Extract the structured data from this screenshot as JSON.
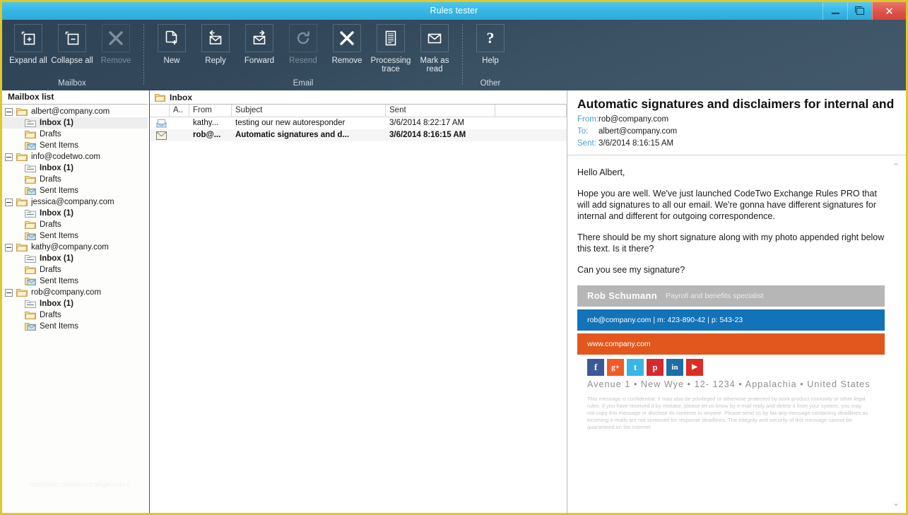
{
  "window": {
    "title": "Rules tester",
    "minimize_label": "Minimize",
    "maximize_label": "Restore",
    "close_label": "✕"
  },
  "ribbon": {
    "groups": [
      {
        "name": "Mailbox",
        "label": "Mailbox",
        "buttons": [
          {
            "id": "expand-all",
            "label": "Expand all",
            "icon": "expand-all-icon",
            "disabled": false
          },
          {
            "id": "collapse-all",
            "label": "Collapse all",
            "icon": "collapse-all-icon",
            "disabled": false
          },
          {
            "id": "remove-mailbox",
            "label": "Remove",
            "icon": "close-x-icon",
            "disabled": true
          }
        ]
      },
      {
        "name": "Email",
        "label": "Email",
        "buttons": [
          {
            "id": "new",
            "label": "New",
            "icon": "new-document-icon",
            "disabled": false
          },
          {
            "id": "reply",
            "label": "Reply",
            "icon": "reply-envelope-icon",
            "disabled": false
          },
          {
            "id": "forward",
            "label": "Forward",
            "icon": "forward-envelope-icon",
            "disabled": false
          },
          {
            "id": "resend",
            "label": "Resend",
            "icon": "refresh-circle-icon",
            "disabled": true
          },
          {
            "id": "remove-email",
            "label": "Remove",
            "icon": "close-x-icon",
            "disabled": false
          },
          {
            "id": "processing-trace",
            "label": "Processing\ntrace",
            "icon": "document-lines-icon",
            "disabled": false
          },
          {
            "id": "mark-as-read",
            "label": "Mark as\nread",
            "icon": "open-envelope-icon",
            "disabled": false
          }
        ]
      },
      {
        "name": "Other",
        "label": "Other",
        "buttons": [
          {
            "id": "help",
            "label": "Help",
            "icon": "question-mark-icon",
            "disabled": false
          }
        ]
      }
    ]
  },
  "sidebar": {
    "header": "Mailbox list",
    "watermark": "codetwo.com/exchange-rules",
    "accounts": [
      {
        "name": "albert@company.com",
        "folders": [
          {
            "label": "Inbox (1)",
            "bold": true,
            "selected": true,
            "icon": "inbox-folder-icon"
          },
          {
            "label": "Drafts",
            "bold": false,
            "selected": false,
            "icon": "drafts-folder-icon"
          },
          {
            "label": "Sent Items",
            "bold": false,
            "selected": false,
            "icon": "sent-folder-icon"
          }
        ]
      },
      {
        "name": "info@codetwo.com",
        "folders": [
          {
            "label": "Inbox (1)",
            "bold": true,
            "selected": false,
            "icon": "inbox-folder-icon"
          },
          {
            "label": "Drafts",
            "bold": false,
            "selected": false,
            "icon": "drafts-folder-icon"
          },
          {
            "label": "Sent Items",
            "bold": false,
            "selected": false,
            "icon": "sent-folder-icon"
          }
        ]
      },
      {
        "name": "jessica@company.com",
        "folders": [
          {
            "label": "Inbox (1)",
            "bold": true,
            "selected": false,
            "icon": "inbox-folder-icon"
          },
          {
            "label": "Drafts",
            "bold": false,
            "selected": false,
            "icon": "drafts-folder-icon"
          },
          {
            "label": "Sent Items",
            "bold": false,
            "selected": false,
            "icon": "sent-folder-icon"
          }
        ]
      },
      {
        "name": "kathy@company.com",
        "folders": [
          {
            "label": "Inbox (1)",
            "bold": true,
            "selected": false,
            "icon": "inbox-folder-icon"
          },
          {
            "label": "Drafts",
            "bold": false,
            "selected": false,
            "icon": "drafts-folder-icon"
          },
          {
            "label": "Sent Items",
            "bold": false,
            "selected": false,
            "icon": "sent-folder-icon"
          }
        ]
      },
      {
        "name": "rob@company.com",
        "folders": [
          {
            "label": "Inbox (1)",
            "bold": true,
            "selected": false,
            "icon": "inbox-folder-icon"
          },
          {
            "label": "Drafts",
            "bold": false,
            "selected": false,
            "icon": "drafts-folder-icon"
          },
          {
            "label": "Sent Items",
            "bold": false,
            "selected": false,
            "icon": "sent-folder-icon"
          }
        ]
      }
    ]
  },
  "message_list": {
    "header": "Inbox",
    "columns": [
      "",
      "A..",
      "From",
      "Subject",
      "Sent",
      ""
    ],
    "rows": [
      {
        "icon": "read-envelope-icon",
        "attachment": "",
        "from": "kathy...",
        "subject": "testing our new autoresponder",
        "sent": "3/6/2014 8:22:17 AM",
        "unread": false
      },
      {
        "icon": "unread-envelope-icon",
        "attachment": "",
        "from": "rob@...",
        "subject": "Automatic signatures and d...",
        "sent": "3/6/2014 8:16:15 AM",
        "unread": true
      }
    ]
  },
  "reading_pane": {
    "subject": "Automatic signatures and disclaimers for internal and o...",
    "fields": [
      {
        "label": "From:",
        "value": "rob@company.com"
      },
      {
        "label": "To:",
        "value": "albert@company.com"
      },
      {
        "label": "Sent:",
        "value": "3/6/2014 8:16:15 AM"
      }
    ],
    "body_paragraphs": [
      "Hello Albert,",
      "Hope you are well. We've just launched CodeTwo Exchange Rules PRO that will add signatures to all our email. We're gonna have different signatures for internal and different for outgoing correspondence.",
      "There should be my short signature along with my photo appended right below this text. Is it there?",
      "Can you see my signature?"
    ],
    "signature": {
      "name": "Rob Schumann",
      "role": "Payroll and benefits specialist",
      "contact": "rob@company.com |  m:  423-890-42 | p: 543-23",
      "website": "www.company.com",
      "address": "Avenue 1 • New Wye  • 12- 1234 • Appalachia • United States",
      "social": [
        {
          "name": "facebook-icon",
          "glyph": "f",
          "color": "#3b5998"
        },
        {
          "name": "googleplus-icon",
          "glyph": "g+",
          "color": "#f05a28"
        },
        {
          "name": "twitter-icon",
          "glyph": "t",
          "color": "#38b6e8"
        },
        {
          "name": "pinterest-icon",
          "glyph": "p",
          "color": "#d8282f"
        },
        {
          "name": "linkedin-icon",
          "glyph": "in",
          "color": "#1c6ea9"
        },
        {
          "name": "youtube-icon",
          "glyph": "▶",
          "color": "#dd2b25"
        }
      ],
      "colors": {
        "name_bar": "#b6b6b6",
        "contact_bar": "#1273b8",
        "website_bar": "#e2571e"
      }
    },
    "legal_text": "This message is confidential. It may also be privileged or otherwise protected by work product immunity or other legal rules. If you have received it by mistake, please let us know by e-mail reply and delete it from your system; you may not copy this message or disclose its contents to anyone. Please send us by fax any message containing deadlines as incoming e-mails are not screened for response deadlines. The integrity and security of this message cannot be guaranteed on the Internet.",
    "scroll_up": "⌃",
    "scroll_down": "⌄"
  },
  "theme": {
    "accent_blue": "#35b5e3",
    "ribbon_dark": "#33495b",
    "window_border": "#dfc82b",
    "close_red": "#dd5247"
  }
}
